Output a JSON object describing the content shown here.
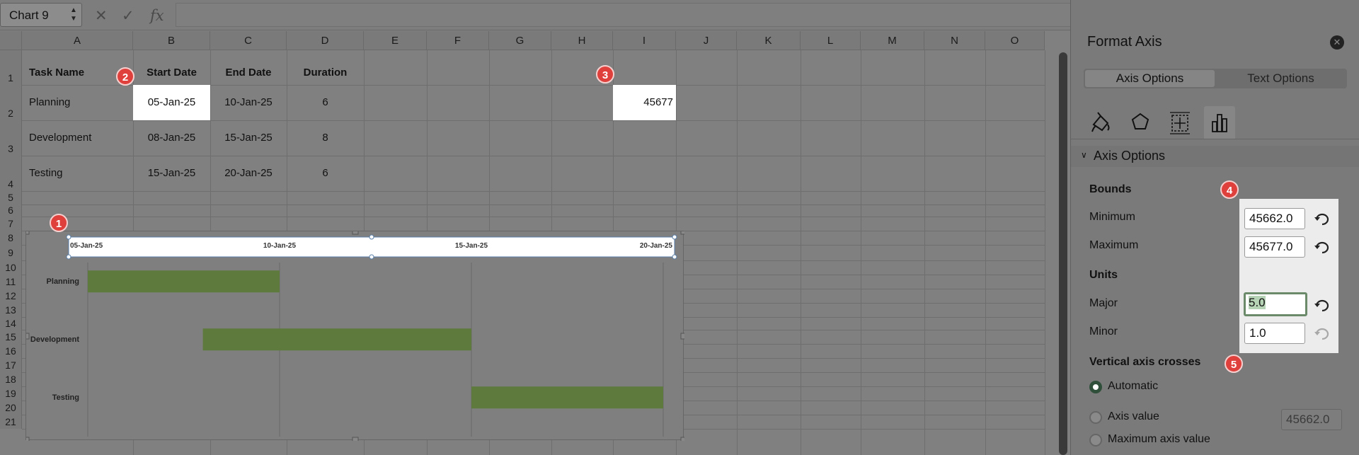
{
  "formula_bar": {
    "name_box": "Chart 9",
    "cancel_icon": "x-icon",
    "enter_icon": "checkmark-icon",
    "fx_label": "fx",
    "formula_value": ""
  },
  "sheet": {
    "columns": [
      "A",
      "B",
      "C",
      "D",
      "E",
      "F",
      "G",
      "H",
      "I",
      "J",
      "K",
      "L",
      "M",
      "N",
      "O"
    ],
    "rows": [
      "1",
      "2",
      "3",
      "4",
      "5",
      "6",
      "7",
      "8",
      "9",
      "10",
      "11",
      "12",
      "13",
      "14",
      "15",
      "16",
      "17",
      "18",
      "19",
      "20",
      "21"
    ],
    "headers": {
      "task_name": "Task Name",
      "start_date": "Start Date",
      "end_date": "End Date",
      "duration": "Duration"
    },
    "tasks": [
      {
        "name": "Planning",
        "start": "05-Jan-25",
        "end": "10-Jan-25",
        "duration": "6"
      },
      {
        "name": "Development",
        "start": "08-Jan-25",
        "end": "15-Jan-25",
        "duration": "8"
      },
      {
        "name": "Testing",
        "start": "15-Jan-25",
        "end": "20-Jan-25",
        "duration": "6"
      }
    ],
    "i2_value": "45677"
  },
  "badges": [
    "1",
    "2",
    "3",
    "4",
    "5"
  ],
  "chart_data": {
    "type": "bar",
    "orientation": "horizontal",
    "categories": [
      "Planning",
      "Development",
      "Testing"
    ],
    "x_tick_labels": [
      "05-Jan-25",
      "10-Jan-25",
      "15-Jan-25",
      "20-Jan-25"
    ],
    "xlim": [
      "05-Jan-25",
      "20-Jan-25"
    ],
    "x_major_unit_days": 5,
    "series": [
      {
        "starts": [
          "05-Jan-25",
          "08-Jan-25",
          "15-Jan-25"
        ],
        "ends": [
          "10-Jan-25",
          "15-Jan-25",
          "20-Jan-25"
        ],
        "color": "#5e7a3c"
      }
    ],
    "grid": true,
    "axis_position": "top"
  },
  "panel": {
    "title": "Format Axis",
    "tabs": [
      "Axis Options",
      "Text Options"
    ],
    "category_icons": [
      "paint-bucket-icon",
      "pentagon-icon",
      "size-properties-icon",
      "bar-chart-icon"
    ],
    "section": "Axis Options",
    "bounds_label": "Bounds",
    "minimum_label": "Minimum",
    "minimum_value": "45662.0",
    "maximum_label": "Maximum",
    "maximum_value": "45677.0",
    "units_label": "Units",
    "major_label": "Major",
    "major_value": "5.0",
    "minor_label": "Minor",
    "minor_value": "1.0",
    "crosses_label": "Vertical axis crosses",
    "automatic_label": "Automatic",
    "axis_value_label": "Axis value",
    "axis_value": "45662.0",
    "max_axis_value_label": "Maximum axis value"
  },
  "colors": {
    "bar": "#5e7a3c",
    "badge": "#e0403c",
    "selection_cell": "#ffffff"
  }
}
